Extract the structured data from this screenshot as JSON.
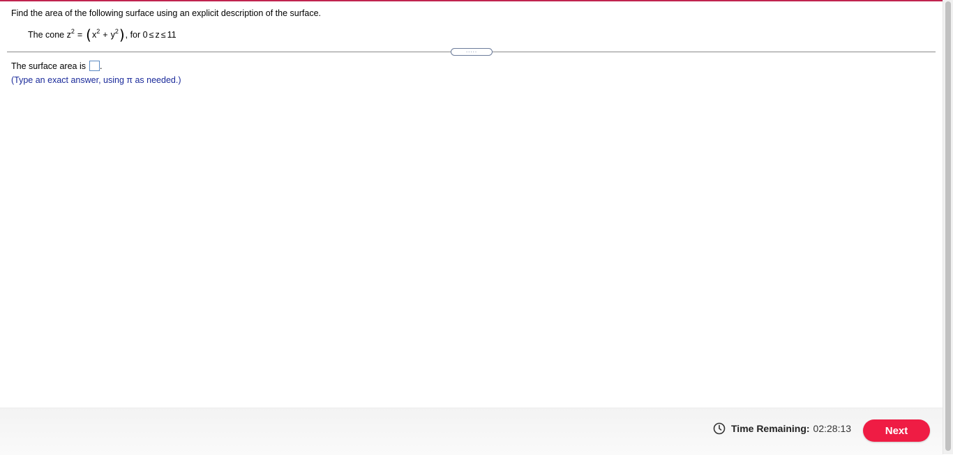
{
  "question": {
    "prompt": "Find the area of the following surface using an explicit description of the surface.",
    "equation": {
      "lead": "The cone z",
      "z_exp": "2",
      "equals": "=",
      "open_paren": "(",
      "x": "x",
      "x_exp": "2",
      "plus": "+",
      "y": "y",
      "y_exp": "2",
      "close_paren": ")",
      "tail": ", for 0",
      "leq1": "≤",
      "z": "z",
      "leq2": "≤",
      "upper": "11"
    }
  },
  "divider": {
    "expand_dots": "....."
  },
  "answer": {
    "label": "The surface area is",
    "period": ".",
    "hint": "(Type an exact answer, using π as needed.)"
  },
  "footer": {
    "timer_label": "Time Remaining:",
    "timer_value": "02:28:13",
    "next_label": "Next",
    "accent_color": "#ef1c44"
  }
}
